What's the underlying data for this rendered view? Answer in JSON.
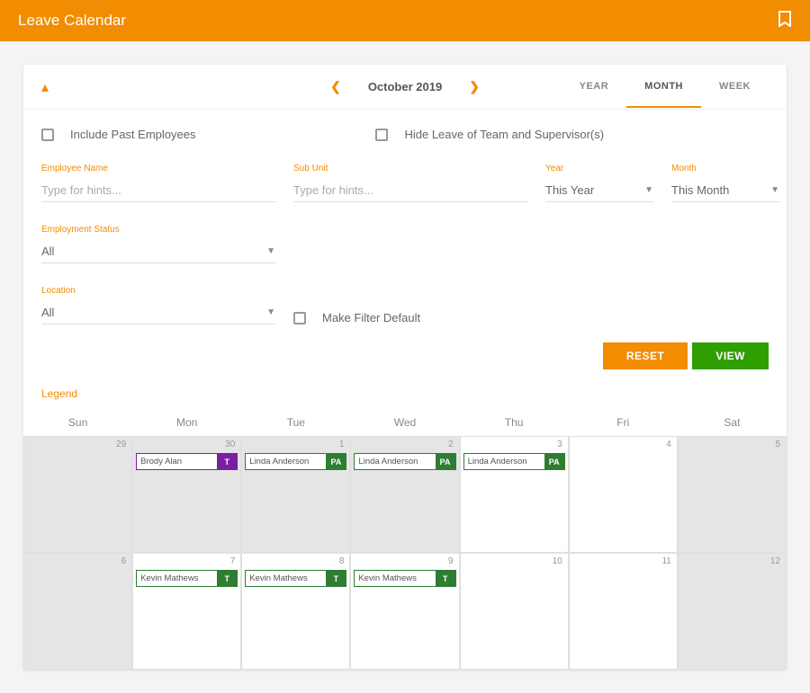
{
  "header": {
    "title": "Leave Calendar"
  },
  "nav": {
    "month_label": "October 2019",
    "tabs": {
      "year": "YEAR",
      "month": "MONTH",
      "week": "WEEK"
    }
  },
  "checkboxes": {
    "include_past": "Include Past Employees",
    "hide_leave": "Hide Leave of Team and Supervisor(s)",
    "make_default": "Make Filter Default"
  },
  "filters": {
    "employee_name": {
      "label": "Employee Name",
      "placeholder": "Type for hints..."
    },
    "sub_unit": {
      "label": "Sub Unit",
      "placeholder": "Type for hints..."
    },
    "year": {
      "label": "Year",
      "value": "This Year"
    },
    "month": {
      "label": "Month",
      "value": "This Month"
    },
    "employment_status": {
      "label": "Employment Status",
      "value": "All"
    },
    "location": {
      "label": "Location",
      "value": "All"
    }
  },
  "buttons": {
    "reset": "RESET",
    "view": "VIEW"
  },
  "legend": "Legend",
  "days": [
    "Sun",
    "Mon",
    "Tue",
    "Wed",
    "Thu",
    "Fri",
    "Sat"
  ],
  "cells": [
    {
      "date": "29",
      "dim": true,
      "events": []
    },
    {
      "date": "30",
      "dim": true,
      "events": [
        {
          "name": "Brody Alan",
          "badge": "T",
          "color": "purple"
        }
      ]
    },
    {
      "date": "1",
      "dim": true,
      "events": [
        {
          "name": "Linda Anderson",
          "badge": "PA",
          "color": "green"
        }
      ]
    },
    {
      "date": "2",
      "dim": true,
      "events": [
        {
          "name": "Linda Anderson",
          "badge": "PA",
          "color": "green"
        }
      ]
    },
    {
      "date": "3",
      "dim": false,
      "events": [
        {
          "name": "Linda Anderson",
          "badge": "PA",
          "color": "green"
        }
      ]
    },
    {
      "date": "4",
      "dim": false,
      "events": []
    },
    {
      "date": "5",
      "dim": true,
      "events": []
    },
    {
      "date": "6",
      "dim": true,
      "events": []
    },
    {
      "date": "7",
      "dim": false,
      "events": [
        {
          "name": "Kevin Mathews",
          "badge": "T",
          "color": "green"
        }
      ]
    },
    {
      "date": "8",
      "dim": false,
      "events": [
        {
          "name": "Kevin Mathews",
          "badge": "T",
          "color": "green"
        }
      ]
    },
    {
      "date": "9",
      "dim": false,
      "events": [
        {
          "name": "Kevin Mathews",
          "badge": "T",
          "color": "green"
        }
      ]
    },
    {
      "date": "10",
      "dim": false,
      "events": []
    },
    {
      "date": "11",
      "dim": false,
      "events": []
    },
    {
      "date": "12",
      "dim": true,
      "events": []
    }
  ]
}
